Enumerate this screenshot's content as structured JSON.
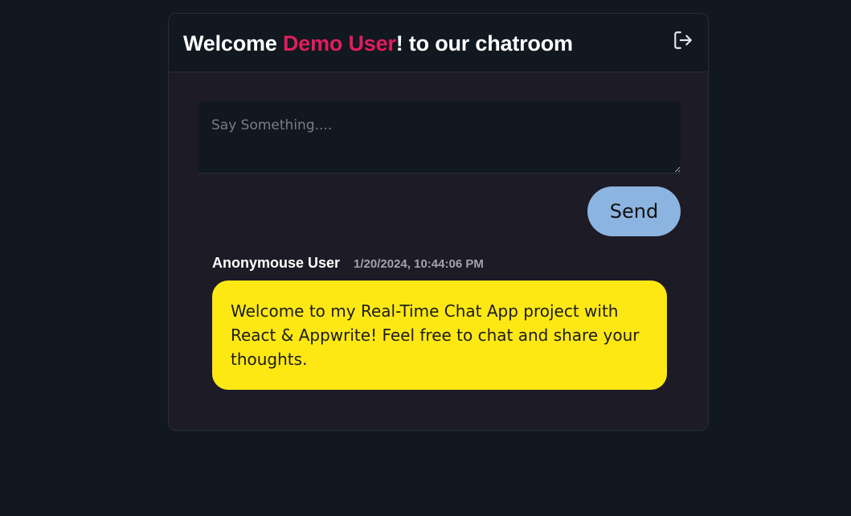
{
  "header": {
    "title_prefix": "Welcome ",
    "username": "Demo User",
    "title_suffix": "! to our chatroom",
    "logout_icon": "logout-icon"
  },
  "composer": {
    "placeholder": "Say Something....",
    "value": "",
    "send_label": "Send"
  },
  "messages": [
    {
      "author": "Anonymouse User",
      "timestamp": "1/20/2024, 10:44:06 PM",
      "body": "Welcome to my Real-Time Chat App project with React & Appwrite! Feel free to chat and share your thoughts."
    }
  ],
  "colors": {
    "background": "#111820",
    "card": "#1d1b26",
    "username_accent": "#e11d5c",
    "send_button": "#8cb4e0",
    "message_bubble": "#fde814"
  }
}
